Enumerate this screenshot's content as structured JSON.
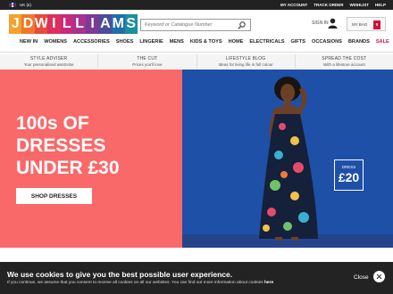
{
  "topbar": {
    "region": "UK (£)",
    "links": [
      "MY ACCOUNT",
      "TRACK ORDER",
      "WISHLIST",
      "HELP"
    ]
  },
  "header": {
    "logo_letters": [
      "J",
      "D",
      "W",
      "I",
      "L",
      "L",
      "I",
      "A",
      "M",
      "S"
    ],
    "logo_colors": [
      "#f4a12b",
      "#f1762a",
      "#ea4a3b",
      "#de2e5b",
      "#c62b7a",
      "#a5338f",
      "#7b3a96",
      "#4c4d9a",
      "#246da8",
      "#1a8fa0"
    ],
    "search_placeholder": "Keyword or Catalogue Number",
    "sign_in": "SIGN IN",
    "bag_label": "MY BAG",
    "bag_count": "0"
  },
  "nav": {
    "items": [
      "NEW IN",
      "WOMENS",
      "ACCESSORIES",
      "SHOES",
      "LINGERIE",
      "MENS",
      "KIDS & TOYS",
      "HOME",
      "ELECTRICALS",
      "GIFTS",
      "OCCASIONS",
      "BRANDS"
    ],
    "sale": "SALE"
  },
  "promos": [
    {
      "title": "STYLE ADVISER",
      "sub": "Your personalised wardrobe"
    },
    {
      "title": "THE CUT",
      "sub": "Prices you'll love"
    },
    {
      "title": "LIFESTYLE BLOG",
      "sub": "Ideas for living life in full colour"
    },
    {
      "title": "SPREAD THE COST",
      "sub": "With a lifestore account"
    }
  ],
  "hero": {
    "headline": "100s OF\nDRESSES\nUNDER £30",
    "cta": "SHOP DRESSES",
    "price_label": "DRESS",
    "price_value": "£20",
    "left_color": "#f96969",
    "right_color": "#1e50a8"
  },
  "cookie": {
    "title": "We use cookies to give you the best possible user experience.",
    "body": "If you continue, we assume that you consent to receive all cookies on all our websites. You can find out more information about cookies ",
    "link": "here",
    "close": "Close"
  }
}
